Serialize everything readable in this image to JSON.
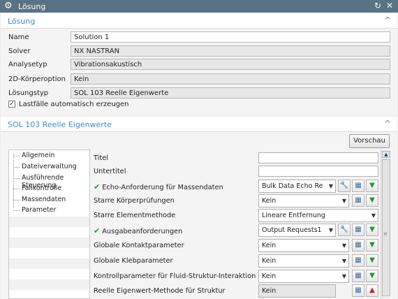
{
  "window": {
    "title": "Lösung",
    "icons": [
      "gear-icon",
      "reset-icon",
      "close-icon"
    ]
  },
  "section1": {
    "title": "Lösung",
    "fields": {
      "name_label": "Name",
      "name_value": "Solution 1",
      "solver_label": "Solver",
      "solver_value": "NX NASTRAN",
      "analysis_label": "Analysetyp",
      "analysis_value": "Vibrationsakustisch",
      "body2d_label": "2D-Körperoption",
      "body2d_value": "Kein",
      "soltype_label": "Lösungstyp",
      "soltype_value": "SOL 103 Reelle Eigenwerte"
    },
    "checkbox_label": "Lastfälle automatisch erzeugen",
    "checkbox_checked": true
  },
  "section2": {
    "title": "SOL 103 Reelle Eigenwerte",
    "vorschau_label": "Vorschau",
    "tree": [
      "Allgemein",
      "Dateiverwaltung",
      "Ausführende Steuerung",
      "Fallkontrolle",
      "Massendaten",
      "Parameter"
    ],
    "props": [
      {
        "label": "Titel",
        "value": ""
      },
      {
        "label": "Untertitel",
        "value": ""
      },
      {
        "label": "Echo-Anforderung für Massendaten",
        "value": "Bulk Data Echo Re"
      },
      {
        "label": "Starre Körperprüfungen",
        "value": "Kein"
      },
      {
        "label": "Starre Elementmethode",
        "value": "Lineare Entfernung"
      },
      {
        "label": "Ausgabeanforderungen",
        "value": "Output Requests1"
      },
      {
        "label": "Globale Kontaktparameter",
        "value": "Kein"
      },
      {
        "label": "Globale Klebparameter",
        "value": "Kein"
      },
      {
        "label": "Kontrollparameter für Fluid-Struktur-Interaktion",
        "value": "Kein"
      },
      {
        "label": "Reelle Eigenwert-Methode für Struktur",
        "value": "Kein"
      }
    ]
  },
  "colors": {
    "titlebar": "#5a7384",
    "accent": "#3a8ed0",
    "check": "#2a9a2a",
    "down_arrow": "#1e9a2a",
    "up_arrow": "#c82020"
  }
}
